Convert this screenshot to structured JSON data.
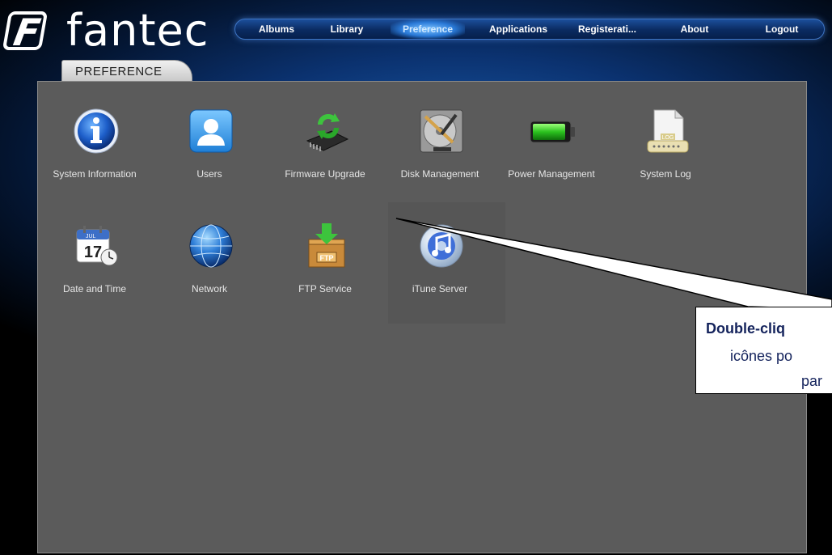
{
  "brand": {
    "name": "fantec",
    "mark": "F"
  },
  "nav": {
    "items": [
      {
        "label": "Albums"
      },
      {
        "label": "Library"
      },
      {
        "label": "Preference",
        "active": true
      },
      {
        "label": "Applications"
      },
      {
        "label": "Registerati..."
      },
      {
        "label": "About"
      },
      {
        "label": "Logout"
      }
    ]
  },
  "tab": {
    "label": "PREFERENCE"
  },
  "items": [
    {
      "label": "System Information",
      "icon": "info-icon"
    },
    {
      "label": "Users",
      "icon": "user-icon"
    },
    {
      "label": "Firmware Upgrade",
      "icon": "firmware-chip-icon"
    },
    {
      "label": "Disk Management",
      "icon": "hard-disk-icon"
    },
    {
      "label": "Power Management",
      "icon": "battery-icon"
    },
    {
      "label": "System Log",
      "icon": "log-file-icon"
    },
    {
      "label": "Date and Time",
      "icon": "calendar-clock-icon",
      "calendar_month": "JUL",
      "calendar_day": "17"
    },
    {
      "label": "Network",
      "icon": "globe-icon"
    },
    {
      "label": "FTP Service",
      "icon": "ftp-box-icon",
      "badge": "FTP"
    },
    {
      "label": "iTune Server",
      "icon": "itunes-icon"
    }
  ],
  "log_badge": "LOG",
  "callout": {
    "line1": "Double-cliq",
    "line2": "icônes po",
    "line3": "par"
  },
  "colors": {
    "panel": "#5b5b5b",
    "nav_bg": "#0a2a60",
    "callout_text": "#14235c"
  }
}
